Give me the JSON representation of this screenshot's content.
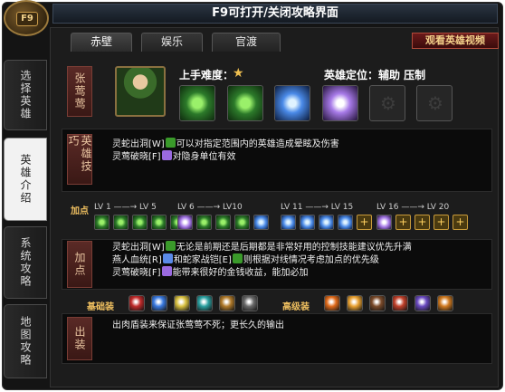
{
  "window": {
    "title": "F9可打开/关闭攻略界面",
    "badge": "F9"
  },
  "side_tabs": [
    {
      "label": "选择英雄",
      "active": false
    },
    {
      "label": "英雄介绍",
      "active": true
    },
    {
      "label": "系统攻略",
      "active": false
    },
    {
      "label": "地图攻略",
      "active": false
    }
  ],
  "top_tabs": [
    {
      "label": "赤壁",
      "active": true
    },
    {
      "label": "娱乐",
      "active": false
    },
    {
      "label": "官渡",
      "active": false
    }
  ],
  "video_button": "观看英雄视频",
  "hero": {
    "name": "张莺莺",
    "difficulty_label": "上手难度：",
    "difficulty_stars": 1,
    "role_label": "英雄定位：辅助  压制",
    "skills": [
      "green",
      "green",
      "blue",
      "violet",
      "locked",
      "locked"
    ]
  },
  "skills_panel": {
    "label": "英雄技巧",
    "lines": [
      {
        "pre": "灵蛇出洞[W]",
        "icon": "g",
        "post": "可以对指定范围内的英雄造成晕眩及伤害"
      },
      {
        "pre": "灵莺破晓[F]",
        "icon": "v",
        "post": "对隐身单位有效"
      }
    ]
  },
  "level_plan": {
    "label": "加点",
    "groups": [
      {
        "label": "LV 1 ——→ LV 5"
      },
      {
        "label": "LV 6 ——→ LV10"
      },
      {
        "label": "LV 11 ——→ LV 15"
      },
      {
        "label": "LV 16 ——→ LV 20"
      }
    ],
    "chips": [
      "g",
      "g",
      "g",
      "g",
      "g",
      "v",
      "g",
      "g",
      "g",
      "b",
      "b",
      "b",
      "b",
      "b",
      "y",
      "v",
      "y",
      "y",
      "y",
      "y"
    ]
  },
  "points_panel": {
    "label": "加点",
    "lines": [
      {
        "pre": "灵蛇出洞[W]",
        "icon": "g",
        "post": "无论是前期还是后期都是非常好用的控制技能建议优先升满"
      },
      {
        "pre": "燕人血统[R]",
        "icon": "b",
        "mid": "和蛇家战铠[E]",
        "icon2": "g",
        "post": "则根据对线情况考虑加点的优先级"
      },
      {
        "pre": "灵莺破晓[F]",
        "icon": "v",
        "post": "能带来很好的金钱收益，能加必加"
      }
    ]
  },
  "equipment": {
    "basic_label": "基础装",
    "advanced_label": "高级装",
    "basic_items": [
      "#c02a2a",
      "#3a7ae0",
      "#d8c040",
      "#2aa0a0",
      "#b07a2a",
      "#6a6a6a"
    ],
    "advanced_items": [
      "#e06a1a",
      "#e8a030",
      "#7a4a2a",
      "#c0402a",
      "#6a4ac0",
      "#d07a20"
    ]
  },
  "gear_panel": {
    "label": "出装",
    "text": "出肉盾装来保证张莺莺不死；更长久的输出"
  }
}
